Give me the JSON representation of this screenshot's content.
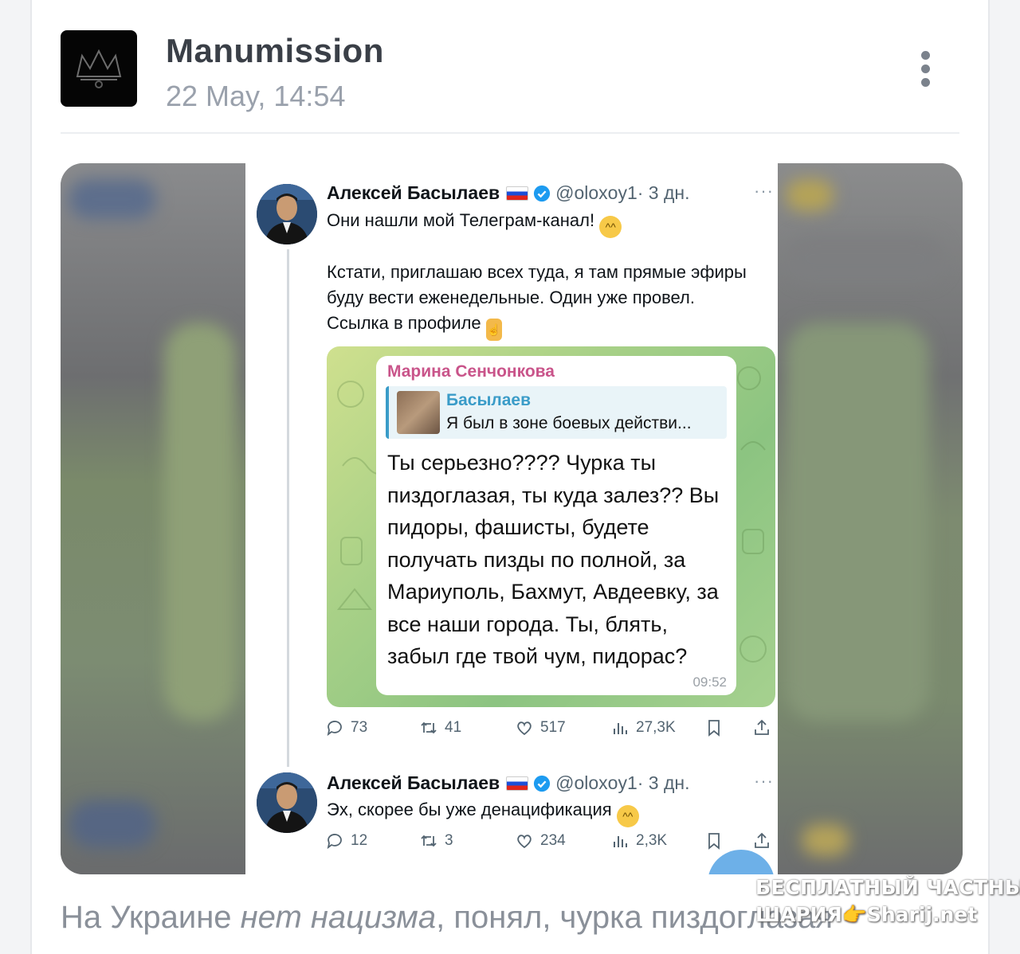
{
  "post": {
    "author": "Manumission",
    "date": "22 May, 14:54",
    "caption_plain_1": "На Украине ",
    "caption_italic": "нет нацизма",
    "caption_plain_2": ", понял, чурка пиздоглазая"
  },
  "tweet1": {
    "name": "Алексей Басылаев",
    "handle": "@oloxoy1",
    "time": "· 3 дн.",
    "line1": "Они нашли мой Телеграм-канал!",
    "para2": "Кстати, приглашаю всех туда, я там прямые эфиры буду вести еженедельные. Один уже провел. Ссылка в профиле",
    "stats": {
      "replies": "73",
      "retweets": "41",
      "likes": "517",
      "views": "27,3K"
    }
  },
  "telegram": {
    "sender": "Марина Сенчонкова",
    "reply_name": "Басылаев",
    "reply_text": "Я был в зоне боевых действи...",
    "body": "Ты серьезно???? Чурка ты пиздоглазая, ты куда залез?? Вы пидоры, фашисты, будете получать пизды по полной, за Мариуполь, Бахмут, Авдеевку, за все наши города. Ты, блять, забыл где твой чум, пидорас?",
    "time": "09:52"
  },
  "tweet2": {
    "name": "Алексей Басылаев",
    "handle": "@oloxoy1",
    "time": "· 3 дн.",
    "text": "Эх, скорее бы уже денацификация",
    "stats": {
      "replies": "12",
      "retweets": "3",
      "likes": "234",
      "views": "2,3K"
    }
  },
  "watermark": {
    "line1": "БЕСПЛАТНЫЙ ЧАСТНЫЙ",
    "line2": "ШАРИЯ👉Sharij.net"
  },
  "colors": {
    "tweet_verified": "#1d9bf0",
    "tg_sender": "#c9548a",
    "tg_reply_accent": "#3a9cc8"
  },
  "icons": [
    "more-vertical-icon",
    "verified-icon",
    "flag-ru-icon",
    "reply-icon",
    "retweet-icon",
    "like-icon",
    "views-icon",
    "bookmark-icon",
    "share-icon"
  ]
}
